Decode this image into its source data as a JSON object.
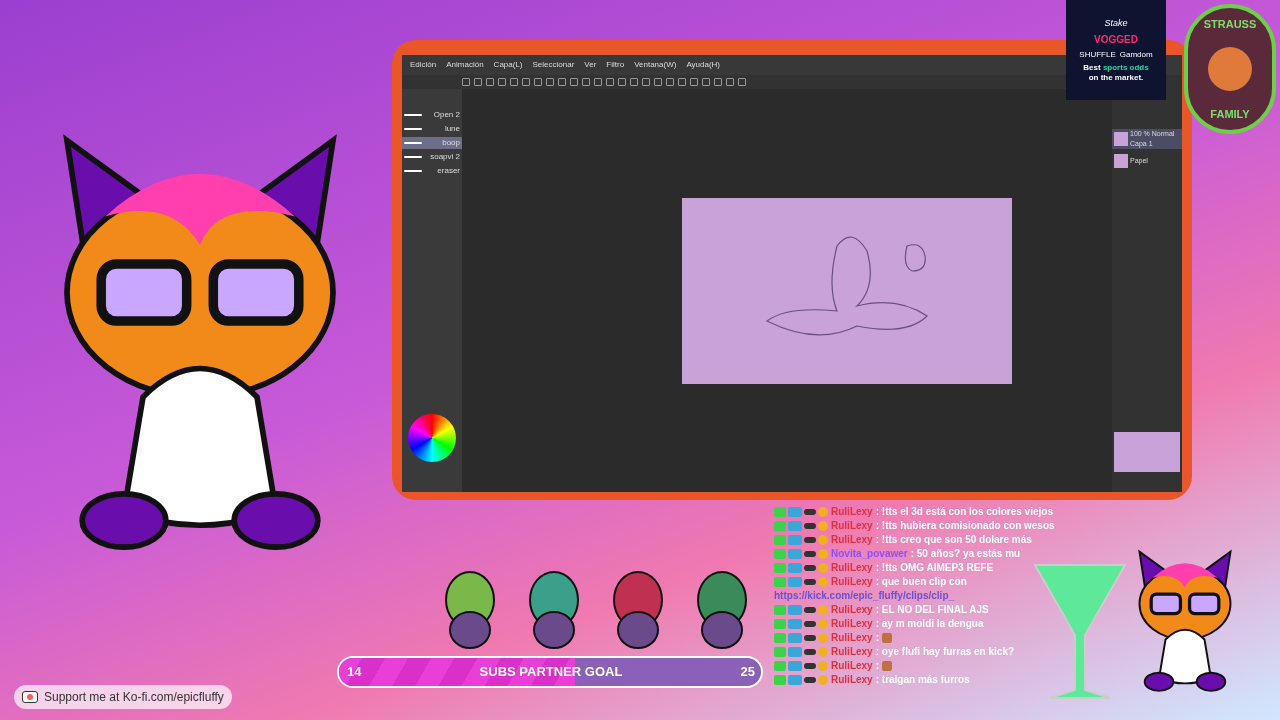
{
  "app": {
    "menu": [
      "Edición",
      "Animación",
      "Capa(L)",
      "Seleccionar",
      "Ver",
      "Filtro",
      "Ventana(W)",
      "Ayuda(H)"
    ],
    "brushes": [
      {
        "name": "Open 2",
        "selected": false
      },
      {
        "name": "lune",
        "selected": false
      },
      {
        "name": "boop",
        "selected": true
      },
      {
        "name": "soapvi 2",
        "selected": false
      },
      {
        "name": "eraser",
        "selected": false
      }
    ],
    "layers": [
      {
        "name": "Capa 1",
        "mode": "100 % Normal",
        "selected": true
      },
      {
        "name": "Papel",
        "selected": false
      }
    ]
  },
  "ad": {
    "brand": "Stake",
    "overlay": "VOGGED",
    "partners": [
      "SHUFFLE",
      "Gamdom"
    ],
    "tagline_start": "Best",
    "tagline_highlight": "sports odds",
    "tagline_end": "on the market."
  },
  "badge": {
    "top": "STRAUSS",
    "bottom": "FAMILY"
  },
  "chat": [
    {
      "kind": "message",
      "user": "RuliLexy",
      "color": "#e0303a",
      "text": ": !tts el 3d está con los colores viejos"
    },
    {
      "kind": "message",
      "user": "RuliLexy",
      "color": "#e0303a",
      "text": ": !tts hubiera comisionado con wesos"
    },
    {
      "kind": "message",
      "user": "RuliLexy",
      "color": "#e0303a",
      "text": ": !tts creo que son 50 dolare más"
    },
    {
      "kind": "message",
      "user": "Novita_povawer",
      "color": "#8a4fff",
      "text": ": 50 años? ya estás mu"
    },
    {
      "kind": "message",
      "user": "RuliLexy",
      "color": "#e0303a",
      "text": ": !tts OMG AIMEP3 REFE"
    },
    {
      "kind": "message",
      "user": "RuliLexy",
      "color": "#e0303a",
      "text": ": que buen clip con"
    },
    {
      "kind": "link",
      "text": "https://kick.com/epic_fluffy/clips/clip_"
    },
    {
      "kind": "message",
      "user": "RuliLexy",
      "color": "#e0303a",
      "text": ": EL NO DEL FINAL AJS"
    },
    {
      "kind": "message",
      "user": "RuliLexy",
      "color": "#e0303a",
      "text": ": ay m moldi la dengua"
    },
    {
      "kind": "emote",
      "user": "RuliLexy",
      "color": "#e0303a",
      "text": ":"
    },
    {
      "kind": "message",
      "user": "RuliLexy",
      "color": "#e0303a",
      "text": ": oye flufi hay furras en kick?"
    },
    {
      "kind": "emote",
      "user": "RuliLexy",
      "color": "#e0303a",
      "text": ":"
    },
    {
      "kind": "message",
      "user": "RuliLexy",
      "color": "#e0303a",
      "text": ": traigan más furros"
    }
  ],
  "goal": {
    "current": "14",
    "title": "SUBS PARTNER GOAL",
    "target": "25",
    "level": 0.56
  },
  "kofi": {
    "text": "Support me at Ko-fi.com/epicfluffy"
  }
}
